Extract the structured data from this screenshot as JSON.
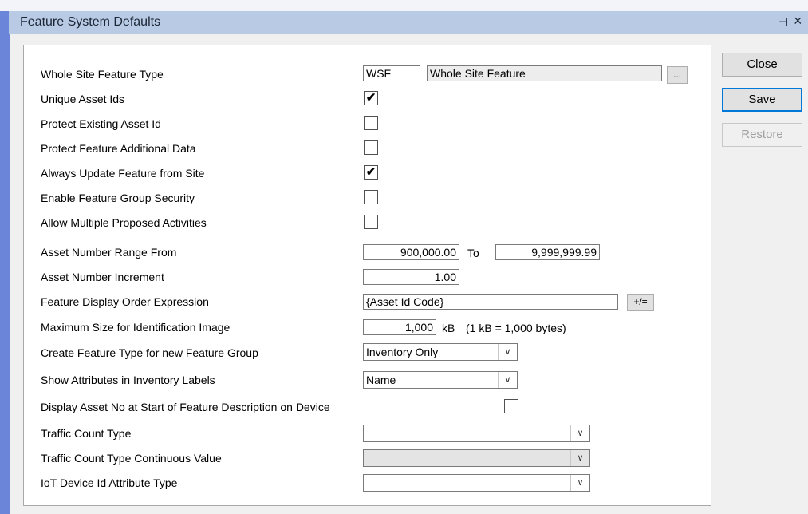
{
  "window": {
    "title": "Feature System Defaults",
    "pin_glyph": "⊣",
    "close_glyph": "×"
  },
  "form": {
    "whole_site_feature_type": {
      "label": "Whole Site Feature Type",
      "code": "WSF",
      "name": "Whole Site Feature",
      "browse": "..."
    },
    "unique_asset_ids": {
      "label": "Unique Asset Ids",
      "checked": true,
      "mark": "✔"
    },
    "protect_existing_asset_id": {
      "label": "Protect Existing Asset Id",
      "checked": false,
      "mark": ""
    },
    "protect_feature_additional_data": {
      "label": "Protect Feature Additional Data",
      "checked": false,
      "mark": ""
    },
    "always_update_feature_from_site": {
      "label": "Always Update Feature from Site",
      "checked": true,
      "mark": "✔"
    },
    "enable_feature_group_security": {
      "label": "Enable Feature Group Security",
      "checked": false,
      "mark": ""
    },
    "allow_multiple_proposed_activities": {
      "label": "Allow Multiple Proposed Activities",
      "checked": false,
      "mark": ""
    },
    "asset_number_range": {
      "label": "Asset Number Range From",
      "from": "900,000.00",
      "to_label": "To",
      "to": "9,999,999.99"
    },
    "asset_number_increment": {
      "label": "Asset Number Increment",
      "value": "1.00"
    },
    "feature_display_order_expression": {
      "label": "Feature Display Order Expression",
      "value": "{Asset Id Code}",
      "button": "+/="
    },
    "maximum_size_identification_image": {
      "label": "Maximum Size for Identification Image",
      "value": "1,000",
      "unit": "kB",
      "note": "(1 kB = 1,000 bytes)"
    },
    "create_feature_type": {
      "label": "Create Feature Type for new Feature Group",
      "value": "Inventory Only"
    },
    "show_attributes_inventory_labels": {
      "label": "Show Attributes in Inventory Labels",
      "value": "Name"
    },
    "display_asset_no": {
      "label": "Display Asset No at Start of Feature Description on Device",
      "checked": false,
      "mark": ""
    },
    "traffic_count_type": {
      "label": "Traffic Count Type",
      "value": ""
    },
    "traffic_count_type_continuous": {
      "label": "Traffic Count Type Continuous Value",
      "value": ""
    },
    "iot_device_id_attribute_type": {
      "label": "IoT Device Id Attribute Type",
      "value": ""
    }
  },
  "combo_arrow": "∨",
  "buttons": {
    "close": "Close",
    "save": "Save",
    "restore": "Restore"
  }
}
